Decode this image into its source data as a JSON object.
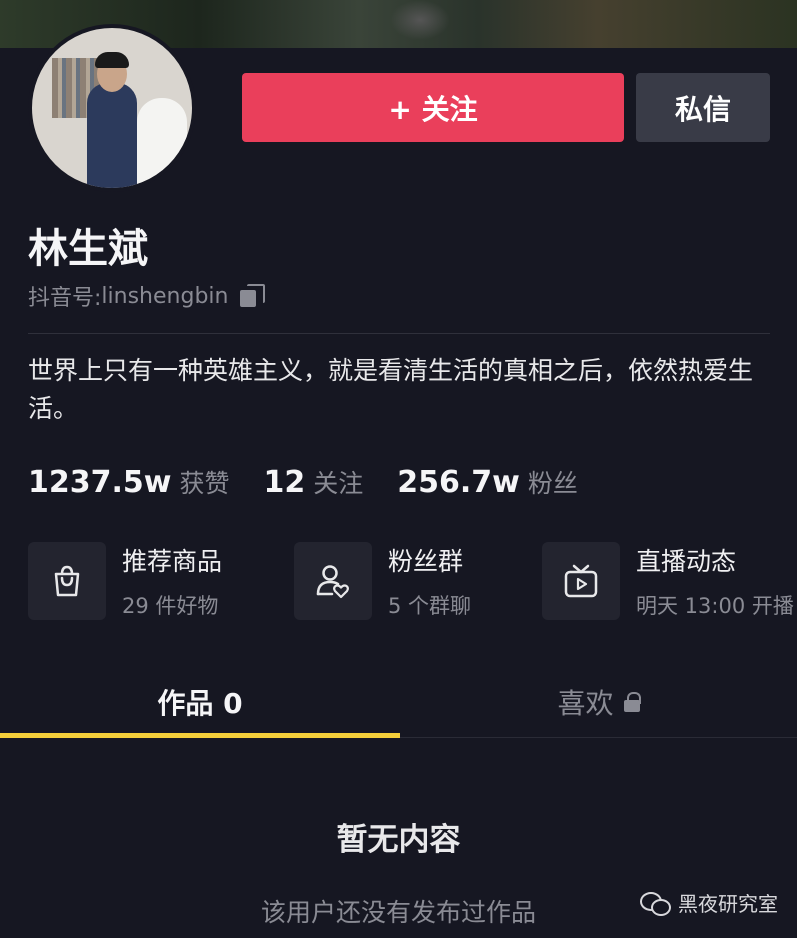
{
  "header": {
    "follow_label": "+ 关注",
    "message_label": "私信"
  },
  "profile": {
    "name": "林生斌",
    "handle_prefix": "抖音号: ",
    "handle": "linshengbin",
    "bio": "世界上只有一种英雄主义，就是看清生活的真相之后，依然热爱生活。"
  },
  "stats": [
    {
      "value": "1237.5w",
      "label": "获赞"
    },
    {
      "value": "12",
      "label": "关注"
    },
    {
      "value": "256.7w",
      "label": "粉丝"
    }
  ],
  "cards": [
    {
      "icon": "shopping-bag-icon",
      "title": "推荐商品",
      "sub": "29 件好物"
    },
    {
      "icon": "fan-group-icon",
      "title": "粉丝群",
      "sub": "5 个群聊"
    },
    {
      "icon": "tv-live-icon",
      "title": "直播动态",
      "sub": "明天 13:00 开播"
    }
  ],
  "tabs": {
    "works": "作品 0",
    "likes": "喜欢"
  },
  "empty": {
    "title": "暂无内容",
    "subtitle": "该用户还没有发布过作品"
  },
  "watermark": "黑夜研究室",
  "colors": {
    "background": "#161722",
    "follow_button": "#ea3f5b",
    "message_button": "#393b47",
    "tab_indicator": "#f4ce3a"
  }
}
